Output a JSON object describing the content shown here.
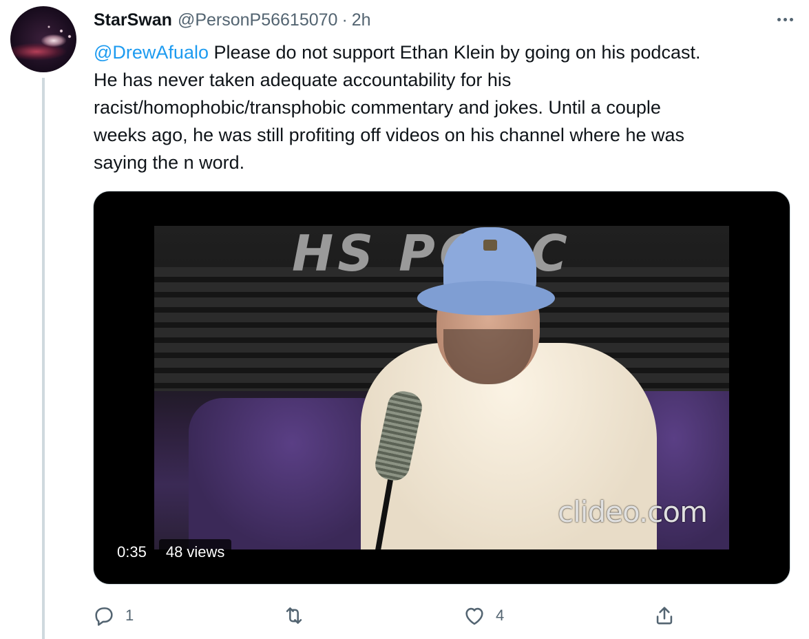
{
  "tweet": {
    "author_name": "StarSwan",
    "author_handle": "@PersonP56615070",
    "separator": "·",
    "time": "2h",
    "mention": "@DrewAfualo",
    "text_line1_rest": " Please do not support Ethan Klein by going on his podcast.",
    "text_line2": "He has never taken adequate accountability for his",
    "text_line3": "racist/homophobic/transphobic commentary and jokes. Until a couple",
    "text_line4": "weeks ago, he was still profiting off videos on his channel where he was",
    "text_line5": "saying the n word."
  },
  "video": {
    "duration": "0:35",
    "views": "48 views",
    "watermark": "clideo.com",
    "sign_text": "HS PODC"
  },
  "actions": {
    "reply_count": "1",
    "retweet_count": "",
    "like_count": "4"
  },
  "icons": {
    "more": "more-dots-icon",
    "reply": "reply-icon",
    "retweet": "retweet-icon",
    "like": "heart-icon",
    "share": "share-icon"
  },
  "colors": {
    "link": "#1d9bf0",
    "secondary_text": "#536471",
    "primary_text": "#0f1419",
    "thread_line": "#cfd9de"
  }
}
